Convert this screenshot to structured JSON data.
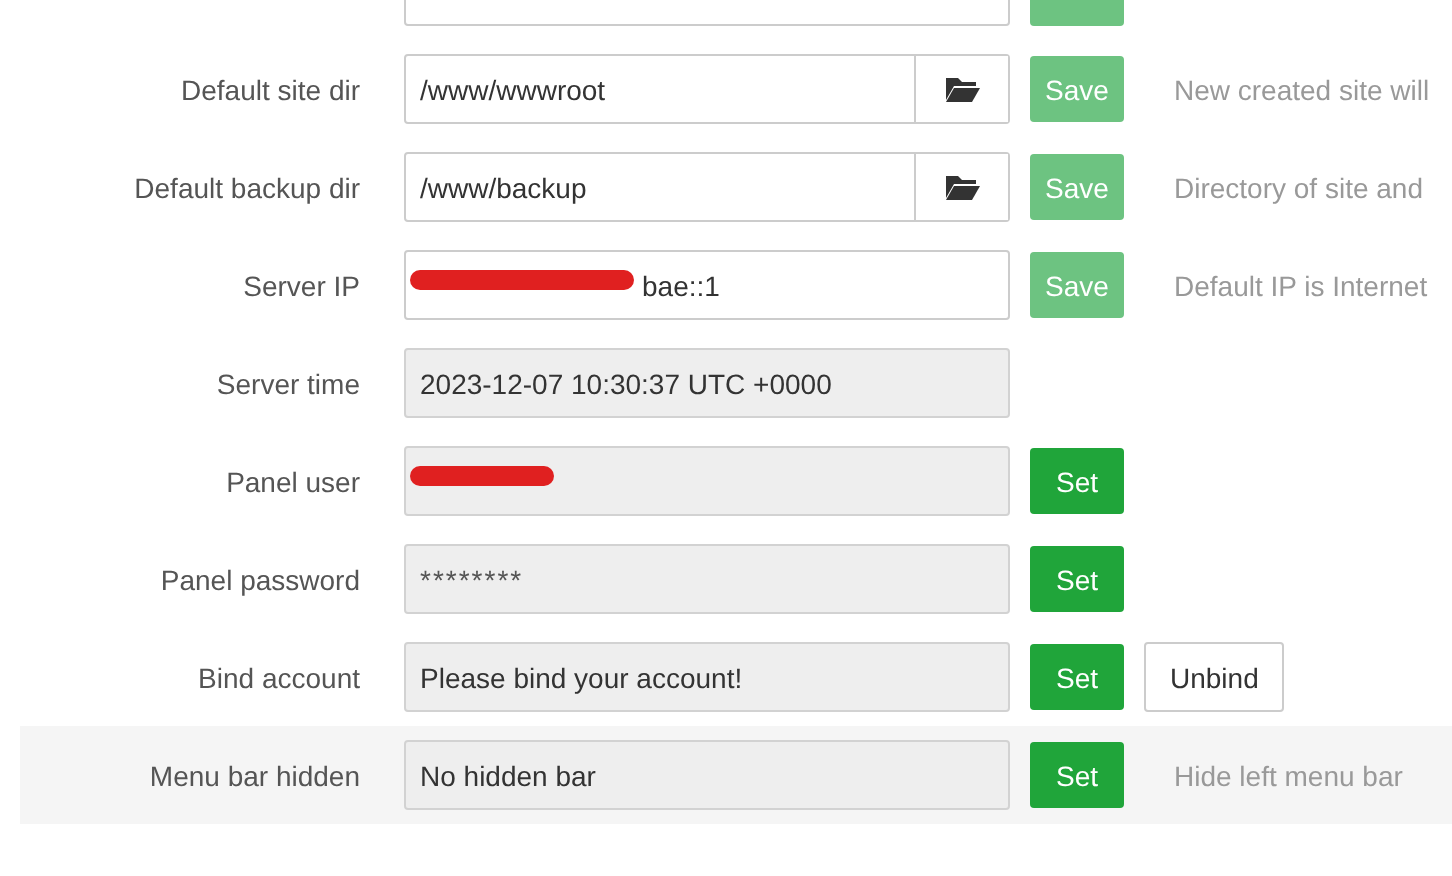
{
  "rows": [
    {
      "kind": "cut",
      "button": {
        "kind": "save"
      }
    },
    {
      "label": "Default site dir",
      "value": "/www/wwwroot",
      "readonly": false,
      "browse": true,
      "button": {
        "kind": "save",
        "label": "Save"
      },
      "hint": "New created site will"
    },
    {
      "label": "Default backup dir",
      "value": "/www/backup",
      "readonly": false,
      "browse": true,
      "button": {
        "kind": "save",
        "label": "Save"
      },
      "hint": "Directory of site and"
    },
    {
      "label": "Server IP",
      "value": "bae::1",
      "readonly": false,
      "redacted": true,
      "button": {
        "kind": "save",
        "label": "Save"
      },
      "hint": "Default IP is Internet"
    },
    {
      "label": "Server time",
      "value": "2023-12-07 10:30:37 UTC +0000",
      "readonly": true
    },
    {
      "label": "Panel user",
      "readonly": true,
      "redacted": true,
      "button": {
        "kind": "set",
        "label": "Set"
      }
    },
    {
      "label": "Panel password",
      "value": "********",
      "readonly": true,
      "button": {
        "kind": "set",
        "label": "Set"
      }
    },
    {
      "label": "Bind account",
      "value": "Please bind your account!",
      "readonly": true,
      "button": {
        "kind": "set",
        "label": "Set"
      },
      "extra": "Unbind"
    },
    {
      "label": "Menu bar hidden",
      "value": "No hidden bar",
      "readonly": true,
      "button": {
        "kind": "set",
        "label": "Set"
      },
      "hint": "Hide left menu bar",
      "highlighted": true
    }
  ]
}
